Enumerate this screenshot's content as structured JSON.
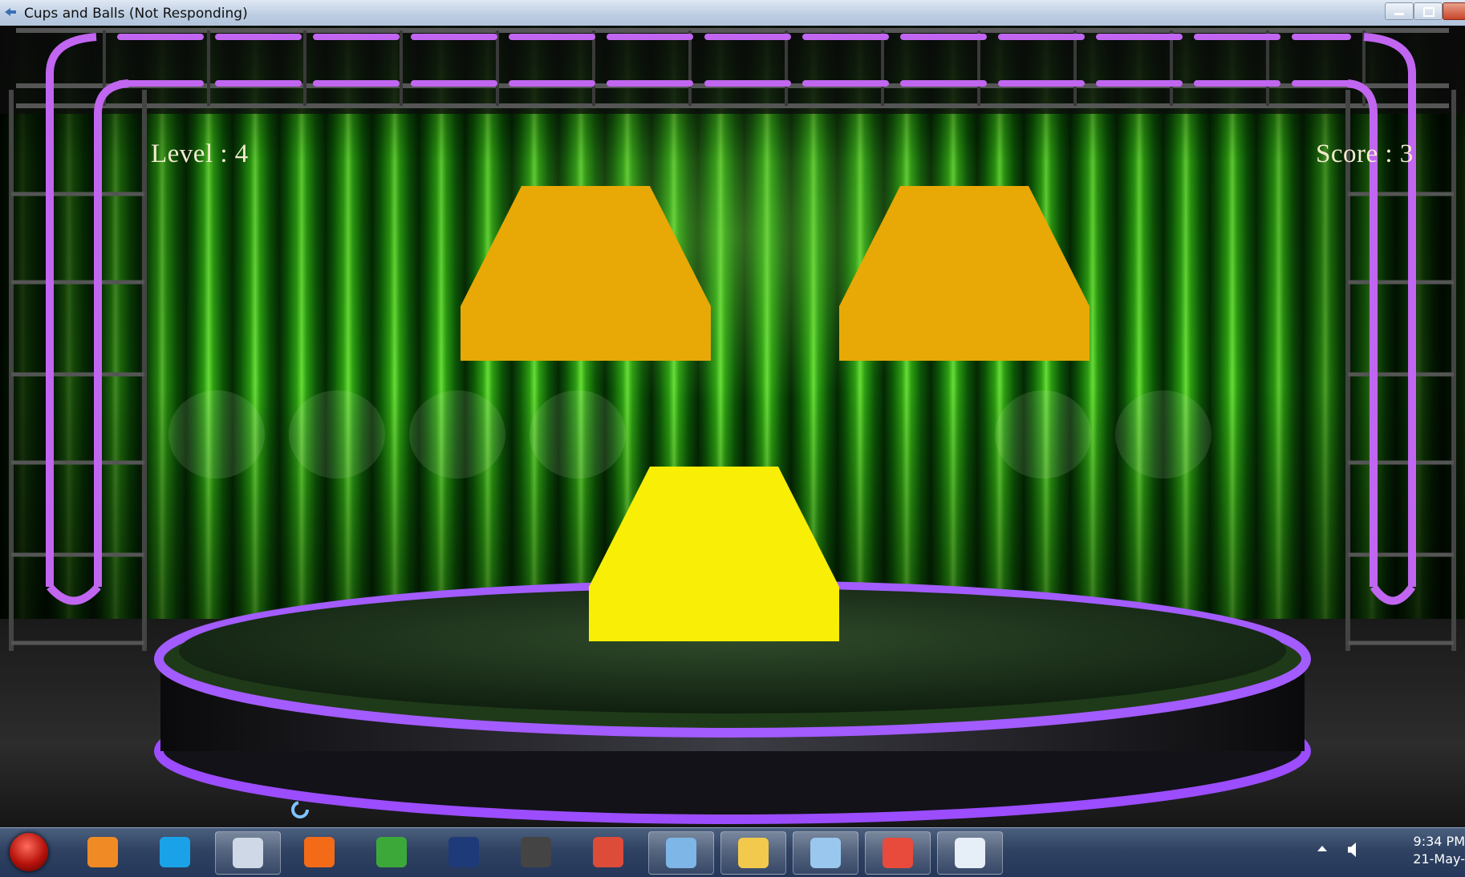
{
  "window": {
    "title": "Cups and Balls (Not Responding)"
  },
  "hud": {
    "level_text": "Level : 4",
    "score_text": "Score : 3"
  },
  "cups": [
    {
      "id": "top-left",
      "color": "#e8a806"
    },
    {
      "id": "top-right",
      "color": "#e8a806"
    },
    {
      "id": "bottom-center",
      "color": "#f8ee06"
    }
  ],
  "colors": {
    "curtain": "#2ea613",
    "truss_neon": "#c166f0",
    "stage_ring": "#9b4dff"
  },
  "taskbar": {
    "items": [
      {
        "name": "media-player-icon",
        "color": "#f08a24"
      },
      {
        "name": "skype-icon",
        "color": "#1aa2e8"
      },
      {
        "name": "app-icon",
        "color": "#cfd8e6"
      },
      {
        "name": "firefox-icon",
        "color": "#f36b17"
      },
      {
        "name": "network-icon",
        "color": "#3da83a"
      },
      {
        "name": "photoshop-icon",
        "color": "#1f3a78"
      },
      {
        "name": "unity-icon",
        "color": "#444444"
      },
      {
        "name": "chrome-icon",
        "color": "#dd4b39"
      },
      {
        "name": "notepad-icon",
        "color": "#7fb6e8"
      },
      {
        "name": "explorer-icon",
        "color": "#f2c94c"
      },
      {
        "name": "paint-icon",
        "color": "#9ac7ee"
      },
      {
        "name": "tiles-icon",
        "color": "#e84b3c"
      },
      {
        "name": "window-icon",
        "color": "#e6eef7"
      }
    ],
    "clock_time": "9:34 PM",
    "clock_date": "21-May-"
  }
}
